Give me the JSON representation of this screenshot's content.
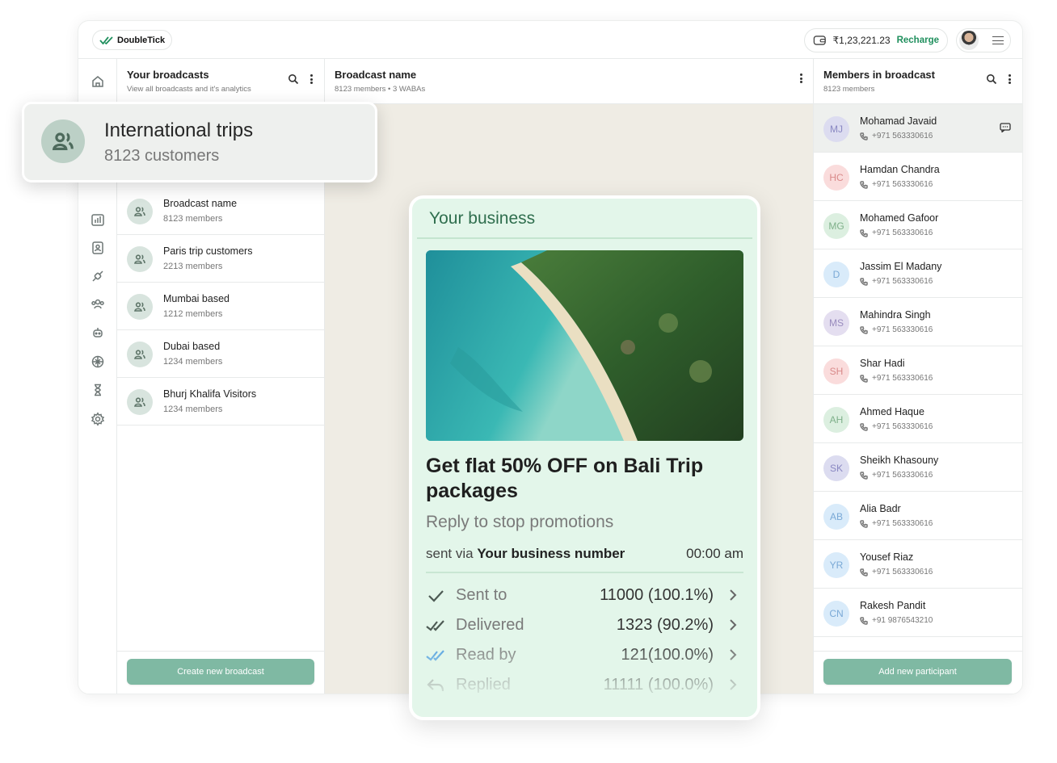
{
  "app": {
    "logo_text": "DoubleTick"
  },
  "topbar": {
    "wallet_amount": "₹1,23,221.23",
    "recharge_label": "Recharge"
  },
  "rail": {
    "icons": [
      "home-icon",
      "chat-icon",
      "broadcast-icon",
      "analytics-icon",
      "contacts-icon",
      "integrations-icon",
      "team-icon",
      "bot-icon",
      "ai-icon",
      "timer-icon",
      "settings-icon"
    ]
  },
  "broadcasts": {
    "title": "Your broadcasts",
    "subtitle": "View all broadcasts and it's analytics",
    "items": [
      {
        "name": "Broadcast name",
        "count": "8123 members"
      },
      {
        "name": "Paris trip customers",
        "count": "2213 members"
      },
      {
        "name": "Mumbai based",
        "count": "1212 members"
      },
      {
        "name": "Dubai based",
        "count": "1234 members"
      },
      {
        "name": "Bhurj Khalifa Visitors",
        "count": "1234 members"
      }
    ],
    "create_label": "Create new broadcast"
  },
  "popup": {
    "title": "International trips",
    "subtitle": "8123 customers"
  },
  "broadcast_detail": {
    "title": "Broadcast name",
    "subtitle": "8123 members • 3 WABAs"
  },
  "message": {
    "header": "Your business",
    "title": "Get flat 50% OFF on Bali Trip packages",
    "reply_text": "Reply to stop promotions",
    "sent_prefix": "sent via",
    "sent_via": "Your business number",
    "time": "00:00 am",
    "stats": [
      {
        "label": "Sent to",
        "value": "11000 (100.1%)",
        "icon": "check-icon",
        "color": "#4d5a54"
      },
      {
        "label": "Delivered",
        "value": "1323 (90.2%)",
        "icon": "double-check-icon",
        "color": "#4d5a54"
      },
      {
        "label": "Read by",
        "value": "121(100.0%)",
        "icon": "double-check-blue-icon",
        "color": "#4a9be0"
      },
      {
        "label": "Replied",
        "value": "11111 (100.0%)",
        "icon": "reply-icon",
        "color": "#7a7a7a"
      }
    ]
  },
  "members": {
    "title": "Members in broadcast",
    "subtitle": "8123 members",
    "items": [
      {
        "initials": "MJ",
        "name": "Mohamad Javaid",
        "phone": "+971 563330616",
        "bg": "#dcdcf0",
        "fg": "#8a88c2"
      },
      {
        "initials": "HC",
        "name": "Hamdan Chandra",
        "phone": "+971 563330616",
        "bg": "#fadcdc",
        "fg": "#d98a8a"
      },
      {
        "initials": "MG",
        "name": "Mohamed Gafoor",
        "phone": "+971 563330616",
        "bg": "#dcefe0",
        "fg": "#7fb08a"
      },
      {
        "initials": "D",
        "name": "Jassim El Madany",
        "phone": "+971 563330616",
        "bg": "#d9ebfa",
        "fg": "#7aa9d6"
      },
      {
        "initials": "MS",
        "name": "Mahindra Singh",
        "phone": "+971 563330616",
        "bg": "#e4def0",
        "fg": "#9a8cbe"
      },
      {
        "initials": "SH",
        "name": "Shar Hadi",
        "phone": "+971 563330616",
        "bg": "#fadcdc",
        "fg": "#d98a8a"
      },
      {
        "initials": "AH",
        "name": "Ahmed Haque",
        "phone": "+971 563330616",
        "bg": "#dcefe0",
        "fg": "#7fb08a"
      },
      {
        "initials": "SK",
        "name": "Sheikh Khasouny",
        "phone": "+971 563330616",
        "bg": "#dcdcf0",
        "fg": "#8a88c2"
      },
      {
        "initials": "AB",
        "name": "Alia Badr",
        "phone": "+971 563330616",
        "bg": "#d9ebfa",
        "fg": "#7aa9d6"
      },
      {
        "initials": "YR",
        "name": "Yousef Riaz",
        "phone": "+971 563330616",
        "bg": "#d9ebfa",
        "fg": "#7aa9d6"
      },
      {
        "initials": "CN",
        "name": "Rakesh Pandit",
        "phone": "+91 9876543210",
        "bg": "#d9ebfa",
        "fg": "#7aa9d6"
      }
    ],
    "add_label": "Add new participant"
  },
  "colors": {
    "accent": "#7fb9a3",
    "brand_green": "#1f8f5d",
    "chat_bg": "#efece4",
    "message_bg": "#e3f6ea"
  }
}
